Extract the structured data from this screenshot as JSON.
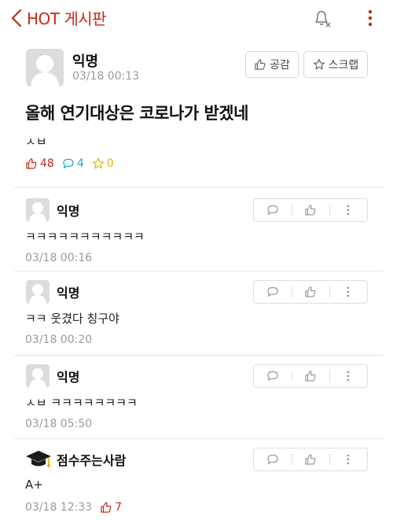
{
  "header": {
    "title": "HOT 게시판"
  },
  "post": {
    "author": "익명",
    "time": "03/18 00:13",
    "like_label": "공감",
    "scrap_label": "스크랩",
    "title": "올해 연기대상은 코로나가 받겠네",
    "body": "ㅅㅂ",
    "likes": "48",
    "comments": "4",
    "scraps": "0"
  },
  "comments": [
    {
      "author": "익명",
      "text": "ㅋㅋㅋㅋㅋㅋㅋㅋㅋㅋㅋ",
      "time": "03/18 00:16"
    },
    {
      "author": "익명",
      "text": "ㅋㅋ 웃겼다 칭구야",
      "time": "03/18 00:20"
    },
    {
      "author": "익명",
      "text": "ㅅㅂ ㅋㅋㅋㅋㅋㅋㅋㅋ",
      "time": "03/18 05:50"
    },
    {
      "author": "점수주는사람",
      "text": "A+",
      "time": "03/18 12:33",
      "likes": "7"
    }
  ],
  "colors": {
    "accent": "#c62917",
    "comment": "#1fa7c8",
    "scrap": "#e2b600",
    "muted": "#9a9a9a"
  }
}
